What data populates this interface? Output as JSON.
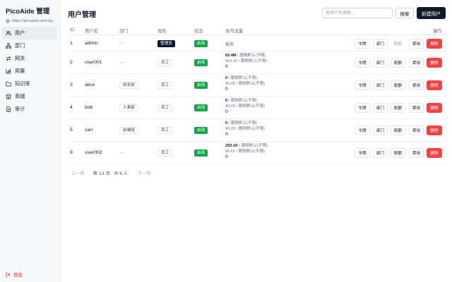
{
  "app": {
    "title": "PicoAide 管理",
    "url": "https://picoaide.next.kg..."
  },
  "sidebar": {
    "items": [
      {
        "label": "用户",
        "icon": "users-icon",
        "active": true
      },
      {
        "label": "部门",
        "icon": "department-icon",
        "active": false
      },
      {
        "label": "网关",
        "icon": "gateway-icon",
        "active": false
      },
      {
        "label": "用量",
        "icon": "usage-icon",
        "active": false
      },
      {
        "label": "知识库",
        "icon": "folder-icon",
        "active": false
      },
      {
        "label": "商城",
        "icon": "store-icon",
        "active": false
      },
      {
        "label": "审计",
        "icon": "audit-icon",
        "active": false
      }
    ],
    "logout_label": "登出"
  },
  "header": {
    "title": "用户管理",
    "search_placeholder": "按用户名搜索...",
    "search_label": "搜索",
    "new_user_label": "新建用户"
  },
  "table": {
    "columns": [
      "ID",
      "用户名",
      "部门",
      "角色",
      "状态",
      "本月流量",
      "操作"
    ],
    "rows": [
      {
        "id": "1",
        "username": "admin",
        "department": "—",
        "role": "管理员",
        "status": "启用",
        "traffic_line1": "",
        "traffic_line1_suffix": "",
        "traffic_line2": "",
        "traffic_line3": "",
        "quota_exempt": "豁免"
      },
      {
        "id": "2",
        "username": "user001",
        "department": "—",
        "role": "员工",
        "status": "启用",
        "traffic_line1": "65.4M",
        "traffic_line1_suffix": " / 跟随默认(不限)",
        "traffic_line2": "¥19.32 / 跟随默认(不限)",
        "traffic_line3": "0",
        "quota_exempt": ""
      },
      {
        "id": "3",
        "username": "alice",
        "department": "研发部",
        "role": "员工",
        "status": "启用",
        "traffic_line1": "0",
        "traffic_line1_suffix": " / 跟随默认(不限)",
        "traffic_line2": "¥0.00 / 跟随默认(不限)",
        "traffic_line3": "0",
        "quota_exempt": ""
      },
      {
        "id": "4",
        "username": "bob",
        "department": "人事部",
        "role": "员工",
        "status": "启用",
        "traffic_line1": "0",
        "traffic_line1_suffix": " / 跟随默认(不限)",
        "traffic_line2": "¥0.00 / 跟随默认(不限)",
        "traffic_line3": "0",
        "quota_exempt": ""
      },
      {
        "id": "5",
        "username": "carl",
        "department": "前端组",
        "role": "员工",
        "status": "启用",
        "traffic_line1": "0",
        "traffic_line1_suffix": " / 跟随默认(不限)",
        "traffic_line2": "¥0.00 / 跟随默认(不限)",
        "traffic_line3": "0",
        "quota_exempt": ""
      },
      {
        "id": "9",
        "username": "user002",
        "department": "—",
        "role": "员工",
        "status": "启用",
        "traffic_line1": "292.1K",
        "traffic_line1_suffix": " / 跟随默认(不限)",
        "traffic_line2": "¥0.61 / 跟随默认(不限)",
        "traffic_line3": "0",
        "quota_exempt": ""
      }
    ],
    "actions": {
      "token": "令牌",
      "department": "部门",
      "quota": "配额",
      "disable": "禁用",
      "delete": "删除"
    }
  },
  "pagination": {
    "prev": "上一页",
    "info": "第 1/1 页 · 共 6 人",
    "next": "下一页"
  },
  "colors": {
    "accent_dark": "#111827",
    "status_green": "#16a34a",
    "danger_red": "#ef4444"
  }
}
